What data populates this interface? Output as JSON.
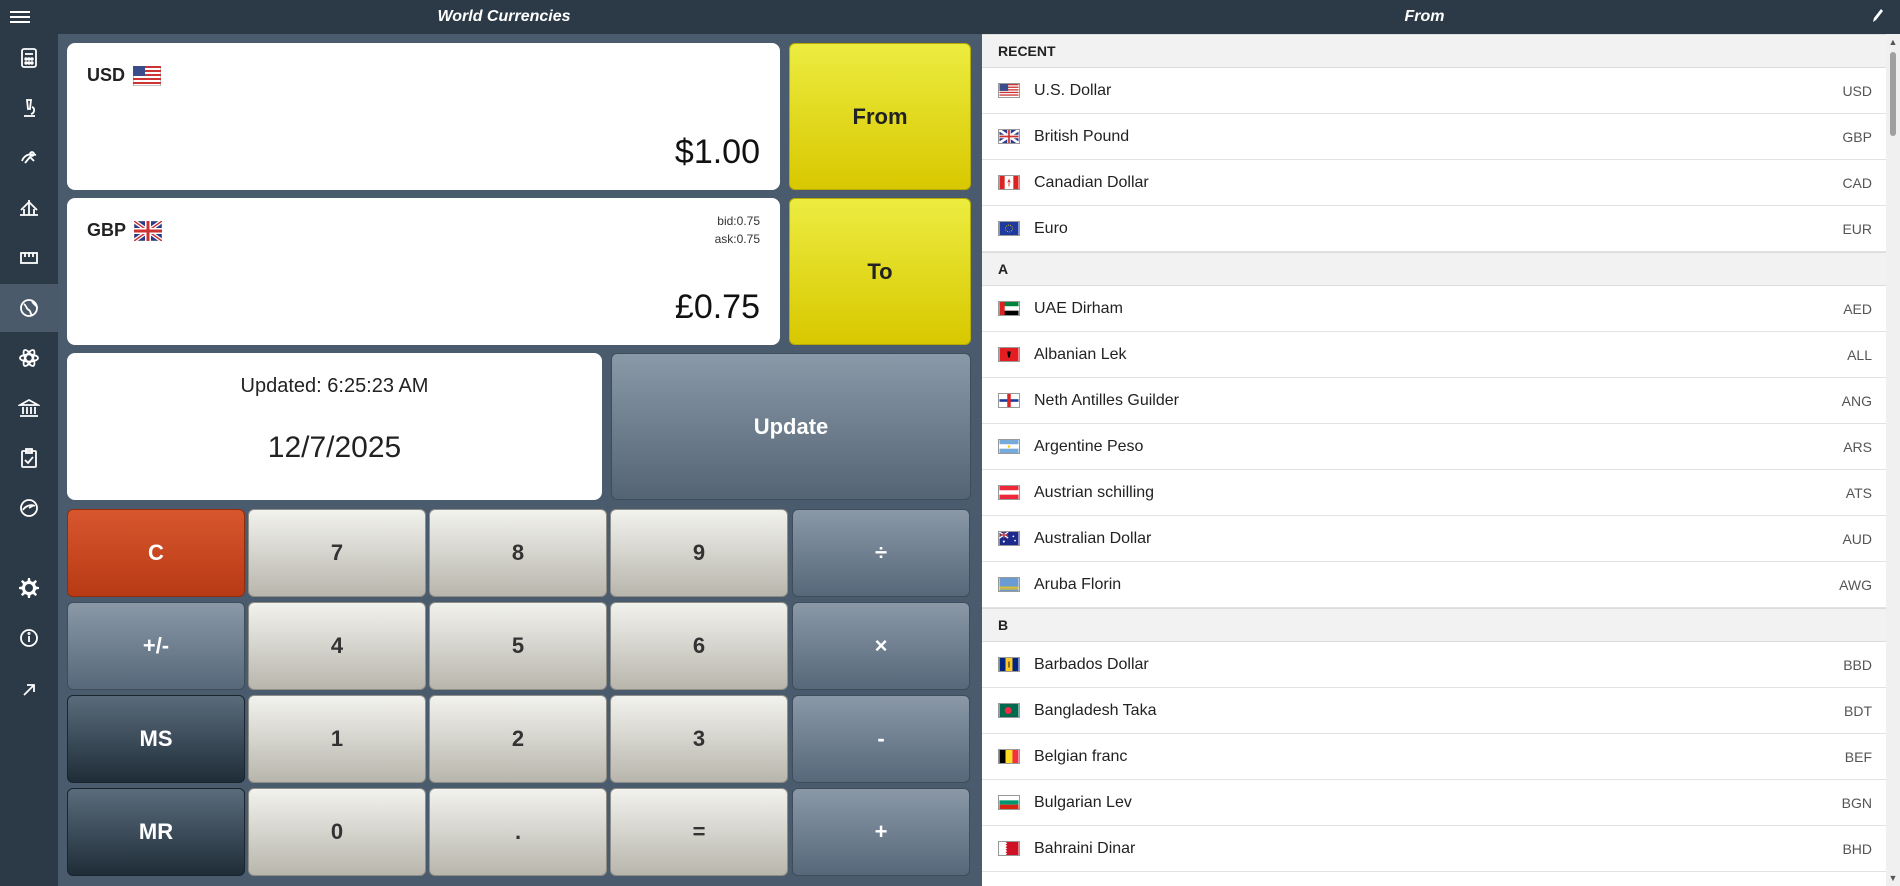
{
  "header": {
    "left_title": "World Currencies",
    "right_title": "From"
  },
  "sidebar": {
    "items": [
      {
        "icon": "calculator-icon"
      },
      {
        "icon": "microscope-icon"
      },
      {
        "icon": "alien-icon"
      },
      {
        "icon": "bridge-icon"
      },
      {
        "icon": "ruler-icon"
      },
      {
        "icon": "globe-icon",
        "active": true
      },
      {
        "icon": "atom-icon"
      },
      {
        "icon": "bank-icon"
      },
      {
        "icon": "clipboard-icon"
      },
      {
        "icon": "globe-speed-icon"
      }
    ],
    "bottom": [
      {
        "icon": "gear-icon"
      },
      {
        "icon": "info-icon"
      },
      {
        "icon": "expand-arrow-icon"
      }
    ]
  },
  "from_card": {
    "code": "USD",
    "amount": "$1.00"
  },
  "to_card": {
    "code": "GBP",
    "bid": "bid:0.75",
    "ask": "ask:0.75",
    "amount": "£0.75"
  },
  "buttons": {
    "from": "From",
    "to": "To",
    "update": "Update"
  },
  "update_card": {
    "updated": "Updated: 6:25:23 AM",
    "date": "12/7/2025"
  },
  "keypad": {
    "clear": "C",
    "sign": "+/-",
    "ms": "MS",
    "mr": "MR",
    "n7": "7",
    "n8": "8",
    "n9": "9",
    "n4": "4",
    "n5": "5",
    "n6": "6",
    "n1": "1",
    "n2": "2",
    "n3": "3",
    "n0": "0",
    "dot": ".",
    "equals": "=",
    "divide": "÷",
    "multiply": "×",
    "minus": "-",
    "plus": "+"
  },
  "list": {
    "recent_header": "RECENT",
    "recent": [
      {
        "name": "U.S. Dollar",
        "code": "USD"
      },
      {
        "name": "British Pound",
        "code": "GBP"
      },
      {
        "name": "Canadian Dollar",
        "code": "CAD"
      },
      {
        "name": "Euro",
        "code": "EUR"
      }
    ],
    "a_header": "A",
    "a": [
      {
        "name": "UAE Dirham",
        "code": "AED"
      },
      {
        "name": "Albanian Lek",
        "code": "ALL"
      },
      {
        "name": "Neth Antilles Guilder",
        "code": "ANG"
      },
      {
        "name": "Argentine Peso",
        "code": "ARS"
      },
      {
        "name": "Austrian schilling",
        "code": "ATS"
      },
      {
        "name": "Australian Dollar",
        "code": "AUD"
      },
      {
        "name": "Aruba Florin",
        "code": "AWG"
      }
    ],
    "b_header": "B",
    "b": [
      {
        "name": "Barbados Dollar",
        "code": "BBD"
      },
      {
        "name": "Bangladesh Taka",
        "code": "BDT"
      },
      {
        "name": "Belgian franc",
        "code": "BEF"
      },
      {
        "name": "Bulgarian Lev",
        "code": "BGN"
      },
      {
        "name": "Bahraini Dinar",
        "code": "BHD"
      }
    ]
  }
}
